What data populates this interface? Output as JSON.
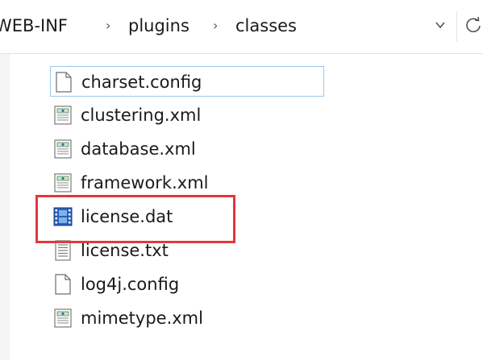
{
  "address_bar": {
    "crumbs": [
      "WEB-INF",
      "plugins",
      "classes"
    ],
    "separator": "›",
    "dropdown_icon": "chevron-down-icon",
    "refresh_icon": "refresh-icon"
  },
  "files": [
    {
      "name": "charset.config",
      "icon": "blank-file-icon",
      "focused": true
    },
    {
      "name": "clustering.xml",
      "icon": "xml-file-icon"
    },
    {
      "name": "database.xml",
      "icon": "xml-file-icon"
    },
    {
      "name": "framework.xml",
      "icon": "xml-file-icon"
    },
    {
      "name": "license.dat",
      "icon": "video-file-icon",
      "highlighted": true
    },
    {
      "name": "license.txt",
      "icon": "text-file-icon"
    },
    {
      "name": "log4j.config",
      "icon": "blank-file-icon"
    },
    {
      "name": "mimetype.xml",
      "icon": "xml-file-icon"
    }
  ],
  "colors": {
    "highlight": "#e0393e",
    "focus_border": "#99c9ef"
  }
}
